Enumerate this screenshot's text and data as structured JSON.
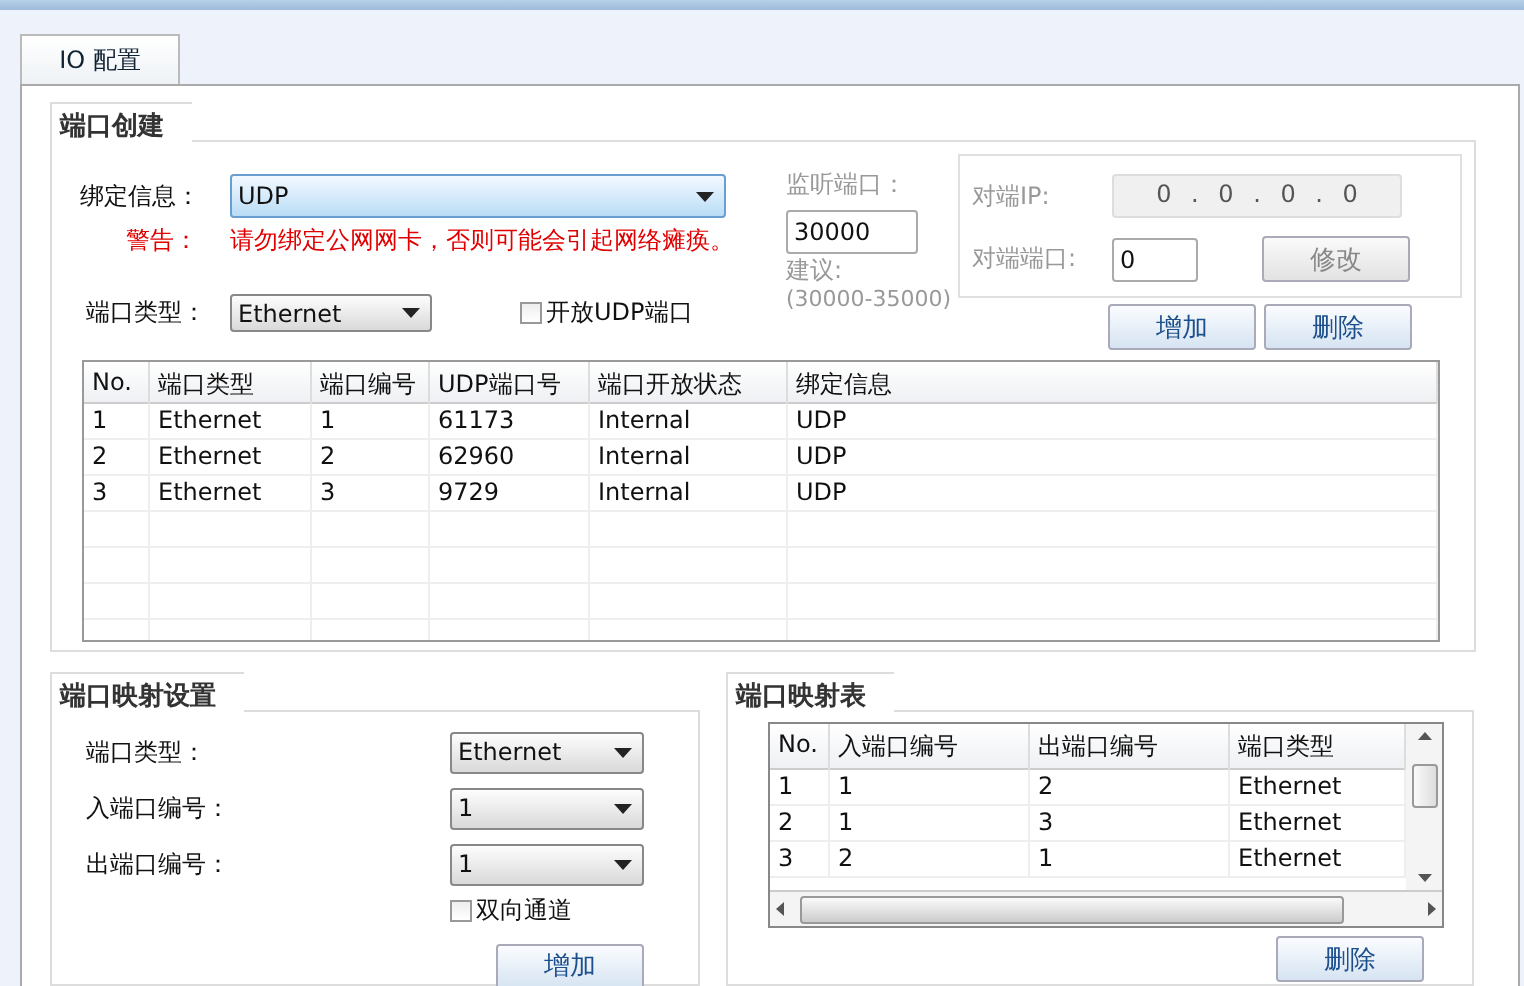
{
  "tabs": [
    {
      "label": "IO 配置",
      "selected": true
    }
  ],
  "port_create": {
    "title": "端口创建",
    "bind_label": "绑定信息：",
    "bind_value": "UDP",
    "warning_label": "警告：",
    "warning_text": "请勿绑定公网网卡，否则可能会引起网络瘫痪。",
    "type_label": "端口类型：",
    "type_value": "Ethernet",
    "open_udp": {
      "label": "开放UDP端口",
      "checked": false
    },
    "listen": {
      "disabled": true,
      "label": "监听端口：",
      "value": "30000",
      "hint_label": "建议:",
      "hint_range": "(30000-35000)"
    },
    "peer": {
      "disabled": true,
      "ip_label": "对端IP:",
      "ip_value": "0 . 0 . 0 . 0",
      "port_label": "对端端口:",
      "port_value": "0",
      "modify_button": "修改"
    },
    "add_button": "增加",
    "delete_button": "删除",
    "table": {
      "columns": [
        "No.",
        "端口类型",
        "端口编号",
        "UDP端口号",
        "端口开放状态",
        "绑定信息"
      ],
      "rows": [
        [
          "1",
          "Ethernet",
          "1",
          "61173",
          "Internal",
          "UDP"
        ],
        [
          "2",
          "Ethernet",
          "2",
          "62960",
          "Internal",
          "UDP"
        ],
        [
          "3",
          "Ethernet",
          "3",
          "9729",
          "Internal",
          "UDP"
        ]
      ]
    }
  },
  "mapping_settings": {
    "title": "端口映射设置",
    "fields": [
      {
        "label": "端口类型：",
        "value": "Ethernet"
      },
      {
        "label": "入端口编号：",
        "value": "1"
      },
      {
        "label": "出端口编号：",
        "value": "1"
      }
    ],
    "bidirectional": {
      "label": "双向通道",
      "checked": false
    },
    "add_button": "增加"
  },
  "mapping_table": {
    "title": "端口映射表",
    "columns": [
      "No.",
      "入端口编号",
      "出端口编号",
      "端口类型"
    ],
    "rows": [
      [
        "1",
        "1",
        "2",
        "Ethernet"
      ],
      [
        "2",
        "1",
        "3",
        "Ethernet"
      ],
      [
        "3",
        "2",
        "1",
        "Ethernet"
      ]
    ],
    "delete_button": "删除"
  }
}
